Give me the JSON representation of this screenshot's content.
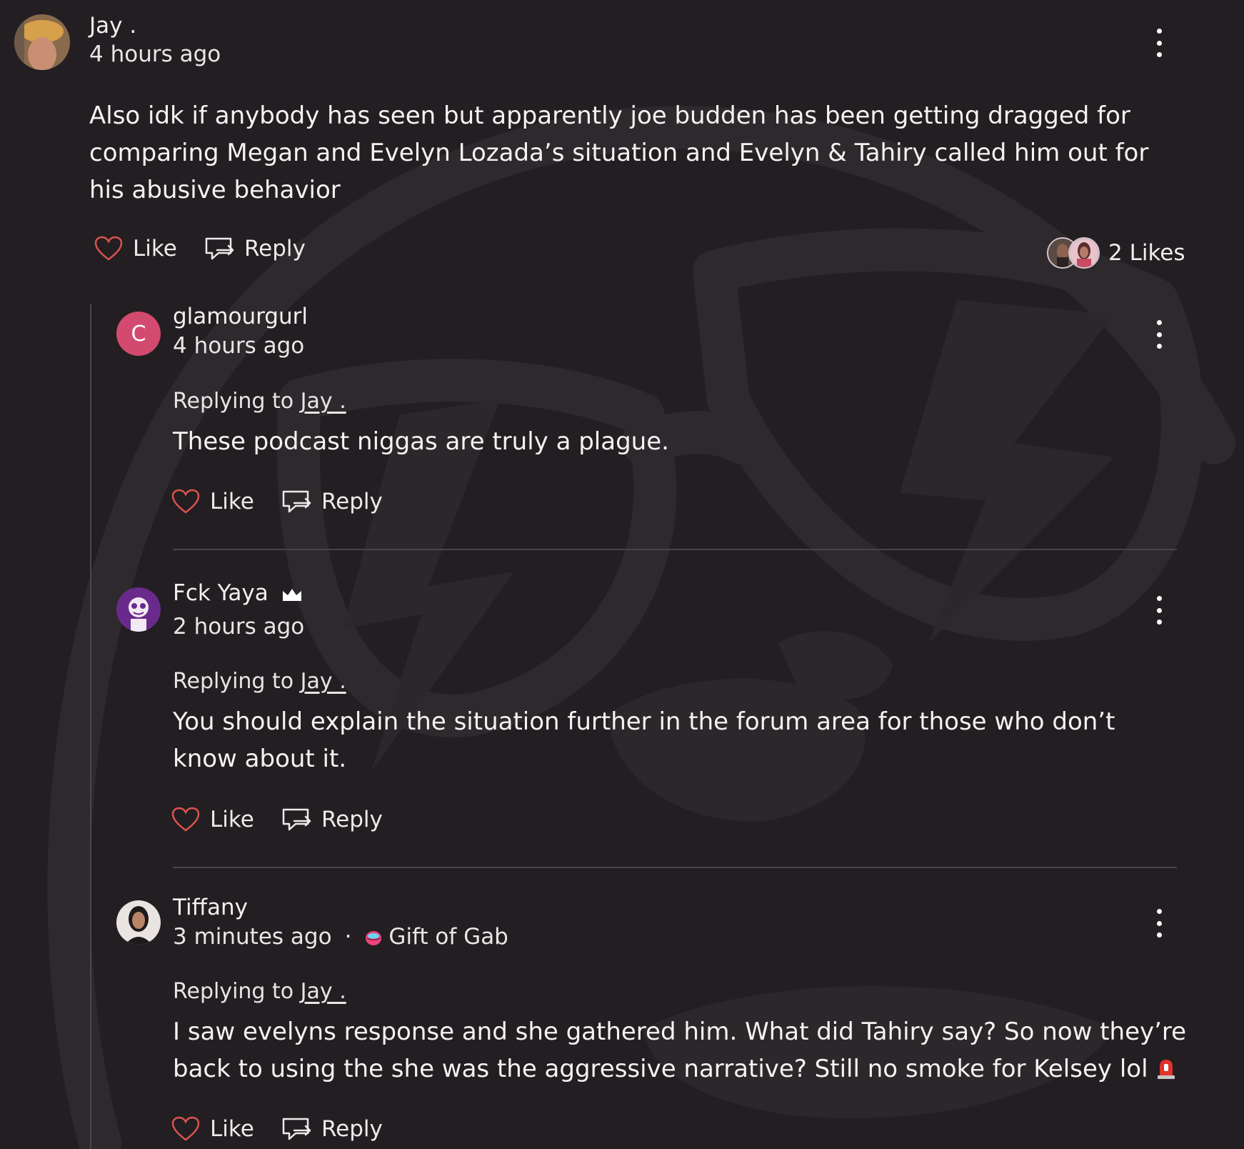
{
  "main_comment": {
    "author": "Jay .",
    "time": "4 hours ago",
    "text": "Also idk if anybody has seen but apparently joe budden has been getting dragged for comparing Megan and Evelyn Lozada’s situation and Evelyn & Tahiry called him out for his abusive behavior",
    "like_label": "Like",
    "reply_label": "Reply",
    "likes_count": "2 Likes"
  },
  "replies": [
    {
      "author": "glamourgurl",
      "avatar_letter": "C",
      "time": "4 hours ago",
      "replying_prefix": "Replying to ",
      "replying_to": "Jay .",
      "text": "These podcast niggas are truly a plague.",
      "like_label": "Like",
      "reply_label": "Reply"
    },
    {
      "author": "Fck Yaya",
      "time": "2 hours ago",
      "replying_prefix": "Replying to ",
      "replying_to": "Jay .",
      "text": "You should explain the situation further in the forum area for those who don’t know about it.",
      "like_label": "Like",
      "reply_label": "Reply"
    },
    {
      "author": "Tiffany",
      "time": "3 minutes ago",
      "separator": "·",
      "badge": "Gift of Gab",
      "replying_prefix": "Replying to ",
      "replying_to": "Jay .",
      "text": "I saw evelyns response and she gathered him. What did Tahiry say? So now they’re back to using the she was the aggressive narrative? Still no smoke for Kelsey lol",
      "like_label": "Like",
      "reply_label": "Reply"
    }
  ],
  "colors": {
    "background": "#221e21",
    "heart": "#d9534f",
    "letter_avatar": "#d34a6f",
    "divider": "#47434a"
  },
  "icons": {
    "like": "heart-outline-icon",
    "reply": "reply-arrow-icon",
    "more": "kebab-menu-icon",
    "premium": "crown-icon",
    "badge": "lips-icon",
    "emoji": "police-siren-icon"
  }
}
